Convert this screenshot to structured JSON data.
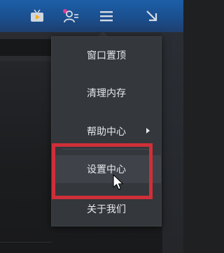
{
  "titlebar": {
    "icons": {
      "tv": "tv-icon",
      "user": "user-skin-icon",
      "menu": "hamburger-menu-icon",
      "minimize": "minimize-arrow-icon"
    },
    "accent": "#1c5fa8"
  },
  "dropdown": {
    "items": [
      {
        "label": "窗口置顶"
      },
      {
        "label": "清理内存"
      },
      {
        "label": "帮助中心"
      },
      {
        "label": "设置中心"
      },
      {
        "label": "关于我们"
      }
    ],
    "highlight_color": "#cf2f38"
  }
}
